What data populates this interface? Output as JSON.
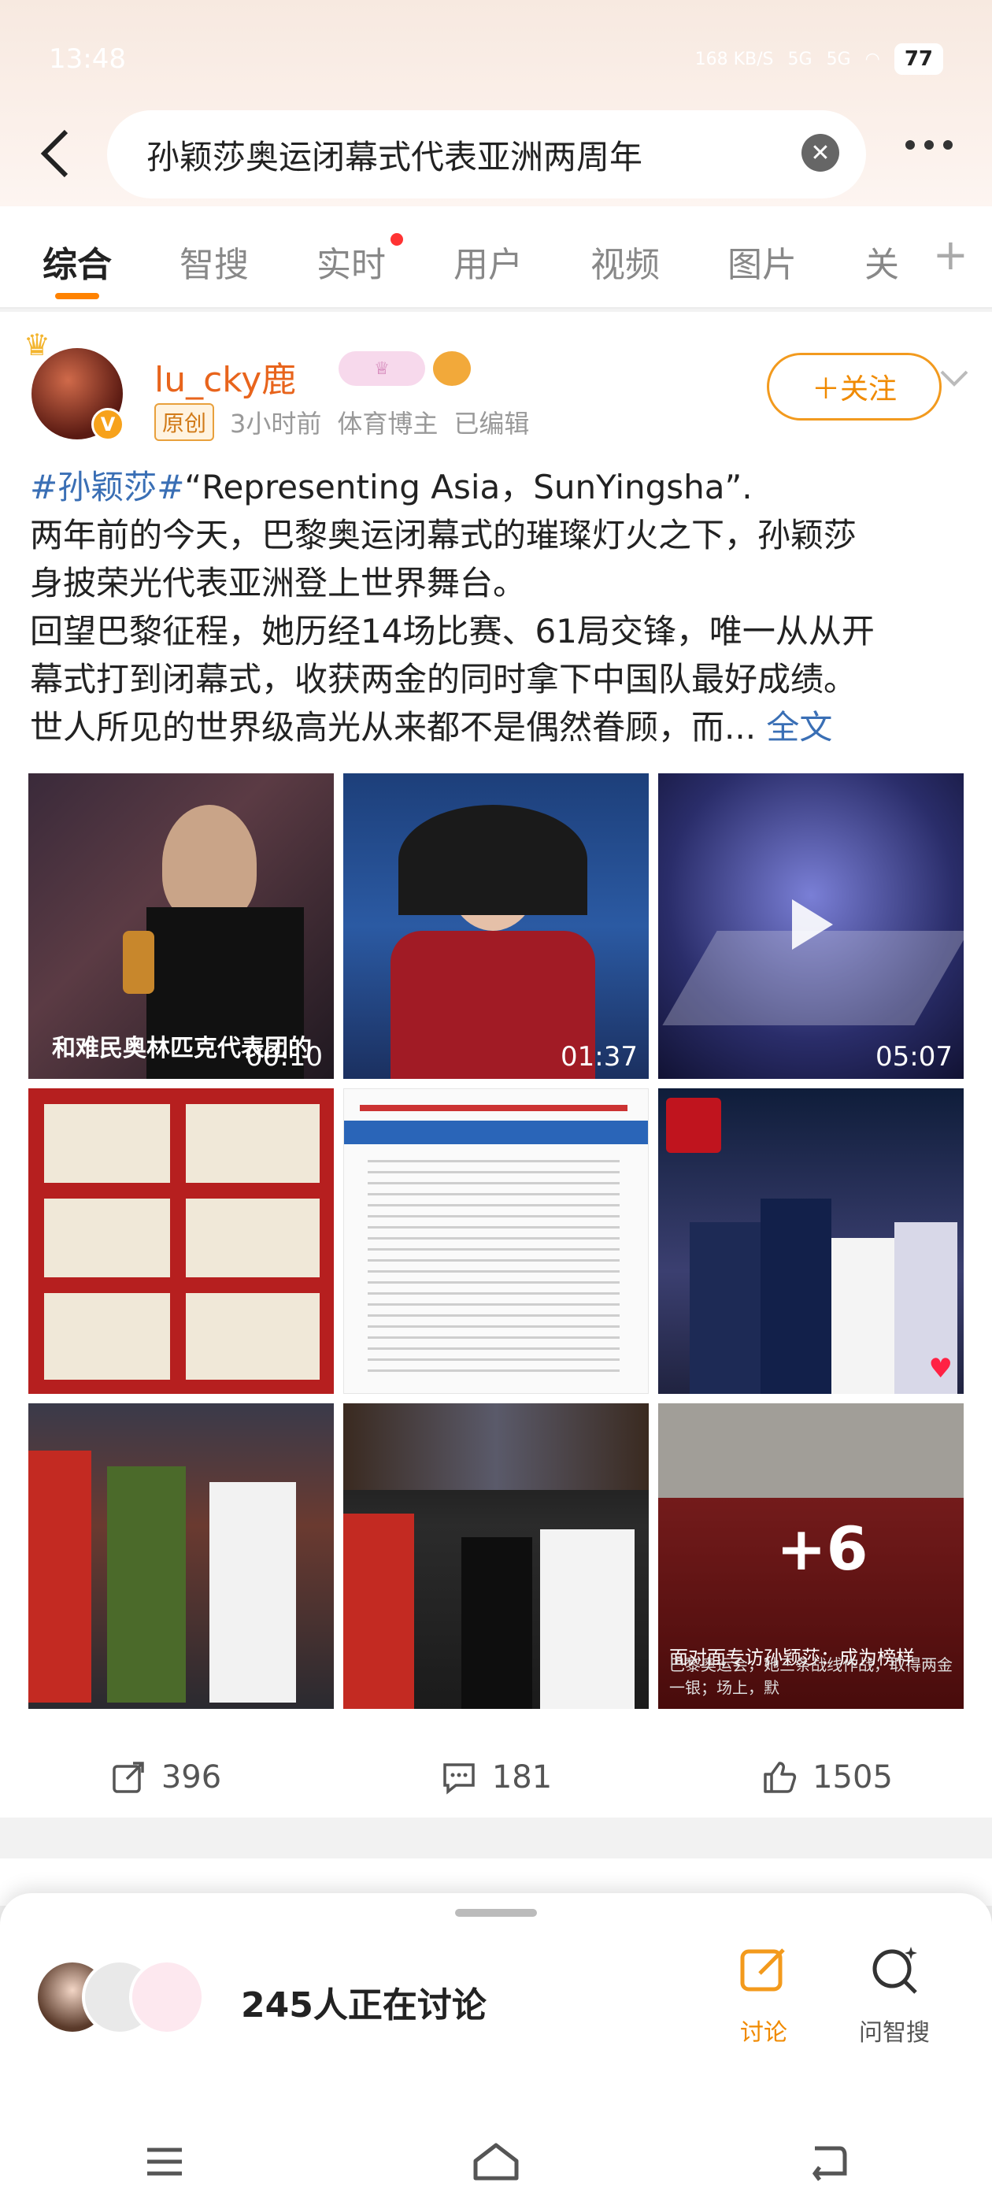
{
  "status": {
    "time": "13:48",
    "net_speed": "168 KB/S",
    "signal1": "5G",
    "signal2": "5G",
    "battery": "77"
  },
  "search": {
    "query": "孙颖莎奥运闭幕式代表亚洲两周年"
  },
  "tabs": [
    {
      "label": "综合"
    },
    {
      "label": "智搜"
    },
    {
      "label": "实时"
    },
    {
      "label": "用户"
    },
    {
      "label": "视频"
    },
    {
      "label": "图片"
    },
    {
      "label": "关"
    }
  ],
  "post": {
    "username": "lu_cky鹿",
    "original_label": "原创",
    "time": "3小时前",
    "source": "体育博主",
    "edited": "已编辑",
    "follow_label": "＋关注",
    "hashtag": "#孙颖莎#",
    "line1_rest": "“Representing Asia，SunYingsha”.",
    "line2": "两年前的今天，巴黎奥运闭幕式的璀璨灯火之下，孙颖莎",
    "line3": "身披荣光代表亚洲登上世界舞台。",
    "line4": "回望巴黎征程，她历经14场比赛、61局交锋，唯一从从开",
    "line5": "幕式打到闭幕式，收获两金的同时拿下中国队最好成绩。",
    "line6": "世人所见的世界级高光从来都不是偶然眷顾，而...",
    "full_text": "全文",
    "video1_caption": "和难民奥林匹克代表团的",
    "video1_duration": "00:10",
    "video2_duration": "01:37",
    "video3_duration": "05:07",
    "more_count": "+6",
    "last_caption": "面对面专访孙颖莎：成为榜样",
    "last_subcaption": "巴黎奥运会，她三条战线作战，取得两金一银；场上，默",
    "reposts": "396",
    "comments": "181",
    "likes": "1505"
  },
  "sheet": {
    "discuss_count": "245人正在讨论",
    "discuss_label": "讨论",
    "ask_label": "问智搜"
  },
  "colors": {
    "accent": "#ff8200",
    "link": "#3a6fb5",
    "username": "#e8641c"
  }
}
